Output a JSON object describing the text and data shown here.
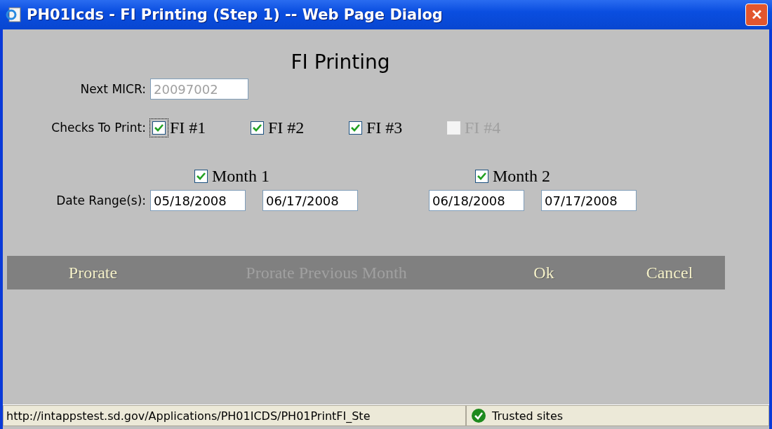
{
  "window": {
    "title": "PH01Icds - FI Printing (Step 1) -- Web Page Dialog",
    "close": "✕"
  },
  "heading": "FI Printing",
  "next_micr": {
    "label": "Next MICR:",
    "value": "20097002",
    "disabled": true
  },
  "checks": {
    "label": "Checks To Print:",
    "items": [
      {
        "label": "FI #1",
        "checked": true,
        "disabled": false,
        "focused": true
      },
      {
        "label": "FI #2",
        "checked": true,
        "disabled": false,
        "focused": false
      },
      {
        "label": "FI #3",
        "checked": true,
        "disabled": false,
        "focused": false
      },
      {
        "label": "FI #4",
        "checked": false,
        "disabled": true,
        "focused": false
      }
    ]
  },
  "months": [
    {
      "label": "Month 1",
      "checked": true,
      "from": "05/18/2008",
      "to": "06/17/2008"
    },
    {
      "label": "Month 2",
      "checked": true,
      "from": "06/18/2008",
      "to": "07/17/2008"
    }
  ],
  "date_label": "Date Range(s):",
  "buttons": [
    {
      "label": "Prorate",
      "disabled": false
    },
    {
      "label": "Prorate Previous Month",
      "disabled": true
    },
    {
      "label": "Ok",
      "disabled": false
    },
    {
      "label": "Cancel",
      "disabled": false
    }
  ],
  "status_bar": {
    "url": "http://intappstest.sd.gov/Applications/PH01ICDS/PH01PrintFI_Ste",
    "zone": "Trusted sites"
  }
}
